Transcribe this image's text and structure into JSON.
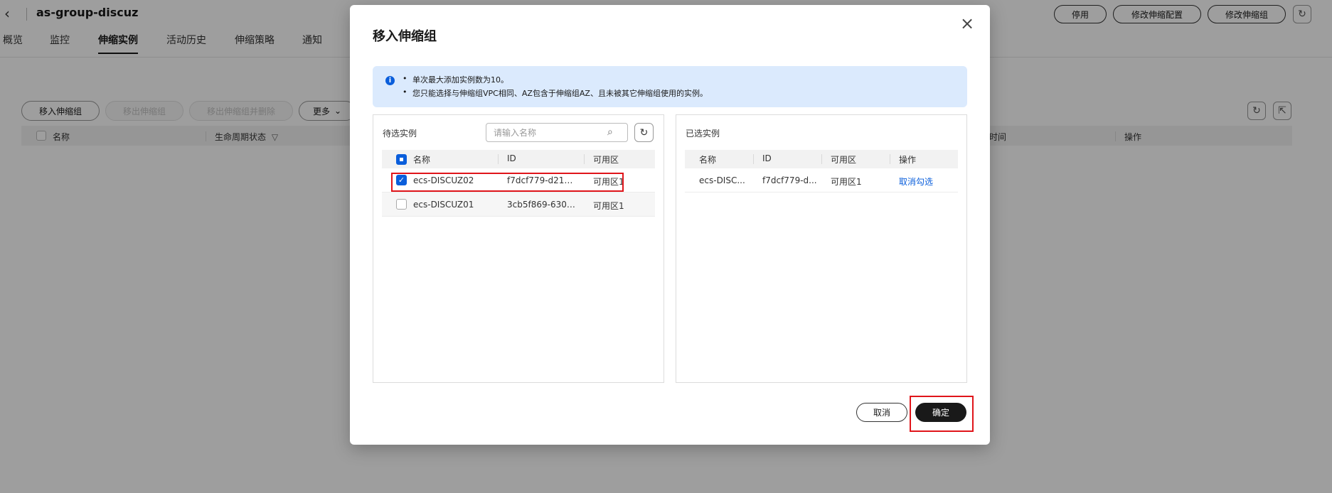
{
  "header": {
    "title": "as-group-discuz",
    "actions": [
      "停用",
      "修改伸缩配置",
      "修改伸缩组"
    ]
  },
  "tabs": [
    "概览",
    "监控",
    "伸缩实例",
    "活动历史",
    "伸缩策略",
    "通知"
  ],
  "active_tab": "伸缩实例",
  "toolbar": {
    "move_in": "移入伸缩组",
    "move_out": "移出伸缩组",
    "move_out_delete": "移出伸缩组并删除",
    "more": "更多"
  },
  "bg_table": {
    "col_name": "名称",
    "col_lifecycle": "生命周期状态",
    "col_time_partial": "时间",
    "col_ops": "操作"
  },
  "modal": {
    "title": "移入伸缩组",
    "info": [
      "单次最大添加实例数为10。",
      "您只能选择与伸缩组VPC相同、AZ包含于伸缩组AZ、且未被其它伸缩组使用的实例。"
    ],
    "left": {
      "label": "待选实例",
      "search_placeholder": "请输入名称",
      "columns": [
        "名称",
        "ID",
        "可用区"
      ],
      "rows": [
        {
          "name": "ecs-DISCUZ02",
          "id": "f7dcf779-d216-...",
          "az": "可用区1",
          "checked": true
        },
        {
          "name": "ecs-DISCUZ01",
          "id": "3cb5f869-6305-...",
          "az": "可用区1",
          "checked": false
        }
      ]
    },
    "right": {
      "label": "已选实例",
      "columns": [
        "名称",
        "ID",
        "可用区",
        "操作"
      ],
      "rows": [
        {
          "name": "ecs-DISC...",
          "id": "f7dcf779-d...",
          "az": "可用区1",
          "action": "取消勾选"
        }
      ]
    },
    "cancel": "取消",
    "confirm": "确定"
  },
  "colors": {
    "primary": "#0a5edb",
    "dark": "#191919",
    "info_bg": "#dbeafd",
    "highlight": "#e0151a"
  }
}
